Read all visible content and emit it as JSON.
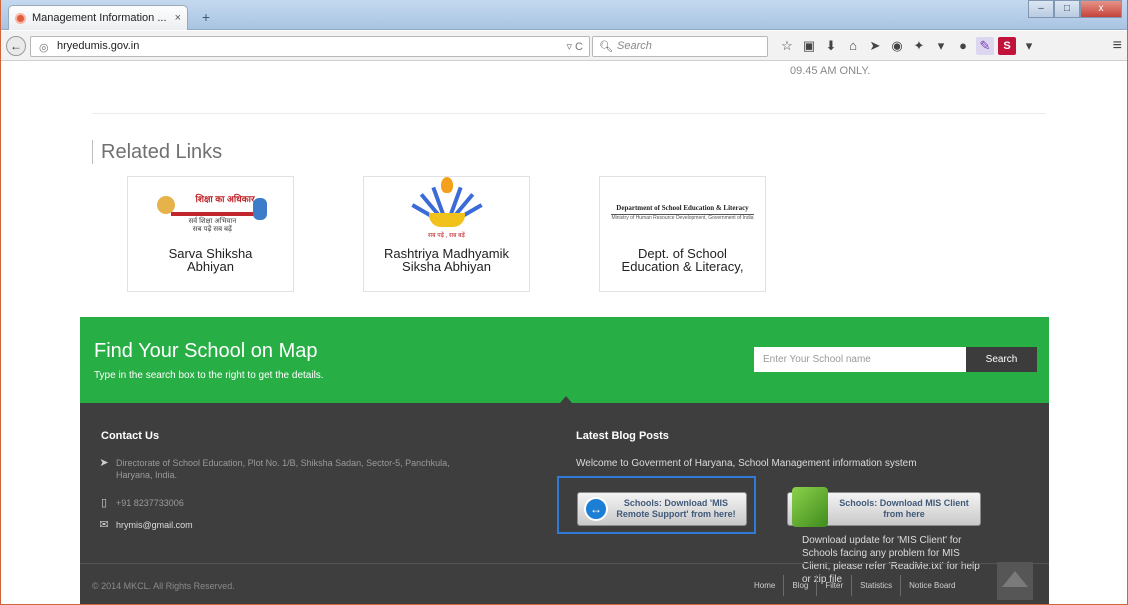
{
  "browser": {
    "tab_title": "Management Information ...",
    "tab_close": "×",
    "new_tab": "+",
    "url": "hryedumis.gov.in",
    "url_tools": "▿ C",
    "search_placeholder": "Search",
    "win_min": "–",
    "win_max": "□",
    "win_close": "x"
  },
  "page": {
    "top_note": "09.45 AM ONLY.",
    "related_links_title": "Related Links",
    "related_links": [
      {
        "label_1": "Sarva Shiksha",
        "label_2": "Abhiyan",
        "logo_text": "शिक्षा का अधिकार",
        "logo_sub_1": "सर्व शिक्षा अभियान",
        "logo_sub_2": "सब पढ़ें सब बढ़ें"
      },
      {
        "label_1": "Rashtriya Madhyamik",
        "label_2": "Siksha Abhiyan",
        "logo_text": "सब पढ़ें , सब बढ़ें"
      },
      {
        "label_1": "Dept. of School",
        "label_2": "Education & Literacy,",
        "logo_text": "Department of School Education & Literacy",
        "logo_sub": "Ministry of Human Resource Development, Government of India"
      }
    ]
  },
  "find_school": {
    "title": "Find Your School on Map",
    "subtitle": "Type in the search box to the right to get the details.",
    "input_placeholder": "Enter Your School name",
    "button_label": "Search"
  },
  "footer": {
    "contact_title": "Contact Us",
    "address_1": "Directorate of School Education, Plot No. 1/B, Shiksha Sadan, Sector-5, Panchkula,",
    "address_2": "Haryana, India.",
    "phone": "+91 8237733006",
    "email": "hrymis@gmail.com",
    "blog_title": "Latest Blog Posts",
    "blog_welcome": "Welcome to Goverment of Haryana, School Management information system",
    "download_remote_1": "Schools: Download 'MIS",
    "download_remote_2": "Remote Support' from here!",
    "download_client_1": "Schools: Download MIS Client",
    "download_client_2": "from here",
    "download_note": "Download update for 'MIS Client' for Schools facing any problem for MIS Client, please refer 'ReadMe.txt' for help or zip file",
    "copyright": "© 2014 MKCL. All Rights Reserved.",
    "links": [
      "Home",
      "Blog",
      "Filter",
      "Statistics",
      "Notice Board"
    ]
  }
}
